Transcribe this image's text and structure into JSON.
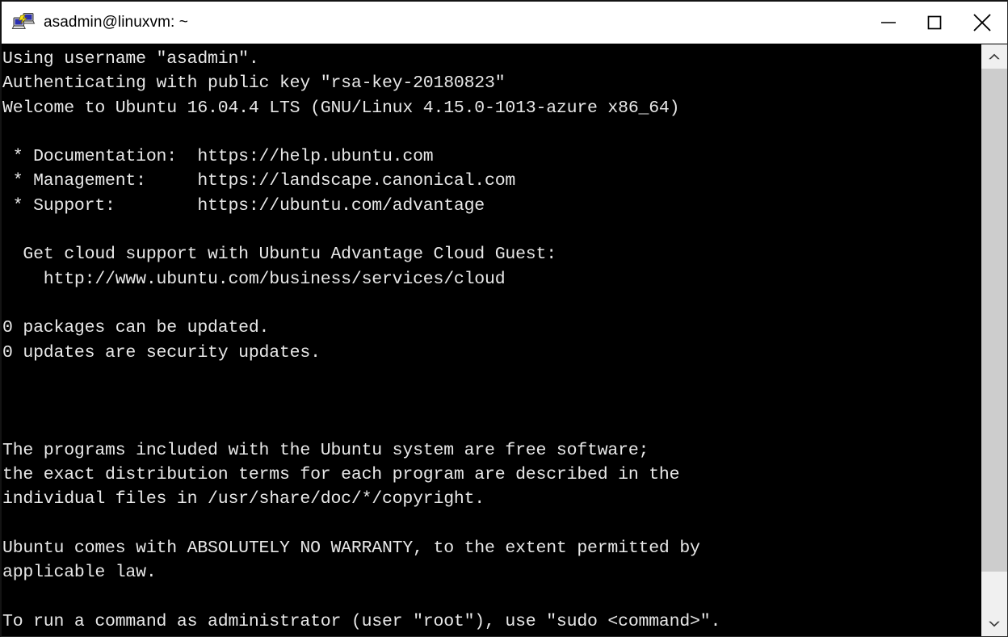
{
  "window": {
    "title": "asadmin@linuxvm: ~",
    "app_icon": "putty-icon",
    "background_color": "#000000",
    "titlebar_color": "#ffffff",
    "text_color": "#e8e8e8"
  },
  "window_controls": {
    "minimize": {
      "name": "minimize-button",
      "glyph": "—"
    },
    "maximize": {
      "name": "maximize-button",
      "glyph": "□"
    },
    "close": {
      "name": "close-button",
      "glyph": "✕"
    }
  },
  "terminal": {
    "lines": [
      "Using username \"asadmin\".",
      "Authenticating with public key \"rsa-key-20180823\"",
      "Welcome to Ubuntu 16.04.4 LTS (GNU/Linux 4.15.0-1013-azure x86_64)",
      "",
      " * Documentation:  https://help.ubuntu.com",
      " * Management:     https://landscape.canonical.com",
      " * Support:        https://ubuntu.com/advantage",
      "",
      "  Get cloud support with Ubuntu Advantage Cloud Guest:",
      "    http://www.ubuntu.com/business/services/cloud",
      "",
      "0 packages can be updated.",
      "0 updates are security updates.",
      "",
      "",
      "",
      "The programs included with the Ubuntu system are free software;",
      "the exact distribution terms for each program are described in the",
      "individual files in /usr/share/doc/*/copyright.",
      "",
      "Ubuntu comes with ABSOLUTELY NO WARRANTY, to the extent permitted by",
      "applicable law.",
      "",
      "To run a command as administrator (user \"root\"), use \"sudo <command>\"."
    ]
  },
  "scrollbar": {
    "up_arrow": "scroll-up-arrow-icon",
    "down_arrow": "scroll-down-arrow-icon",
    "thumb": "scrollbar-thumb",
    "track_color": "#f0f0f0",
    "thumb_color": "#cdcdcd"
  }
}
